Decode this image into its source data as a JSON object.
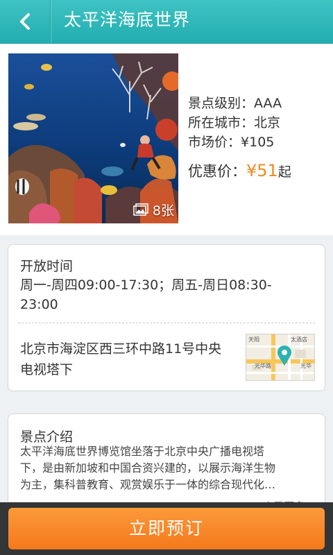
{
  "header": {
    "title": "太平洋海底世界",
    "back_icon": "chevron-left-icon"
  },
  "attraction": {
    "photo_count": "8张",
    "level_label": "景点级别：",
    "level_value": "AAA",
    "city_label": "所在城市：",
    "city_value": "北京",
    "market_label": "市场价：",
    "market_value": "¥105",
    "discount_label": "优惠价：",
    "discount_value": "¥51",
    "discount_suffix": "起"
  },
  "hours": {
    "title": "开放时间",
    "line1": "周一-周四09:00-17:30；周五-周日08:30-",
    "line2": "23:00"
  },
  "location": {
    "line1": "北京市海淀区西三环中路11号中央",
    "line2": "电视塔下",
    "map_labels": {
      "a": "天阳",
      "b": "太酒店",
      "c": "光华路",
      "d": "光华"
    }
  },
  "intro": {
    "title": "景点介绍",
    "line1": "太平洋海底世界博览馆坐落于北京中央广播电视塔",
    "line2": "下，是由新加坡和中国合资兴建的，以展示海洋生物",
    "line3": "为主，集科普教育、观赏娱乐于一体的综合现代化…",
    "more": "查看更多 ›"
  },
  "footer": {
    "book_label": "立即预订"
  },
  "colors": {
    "header": "#2fb6b8",
    "price": "#f08a1d",
    "button": "#f7861f",
    "bar": "#333537"
  }
}
